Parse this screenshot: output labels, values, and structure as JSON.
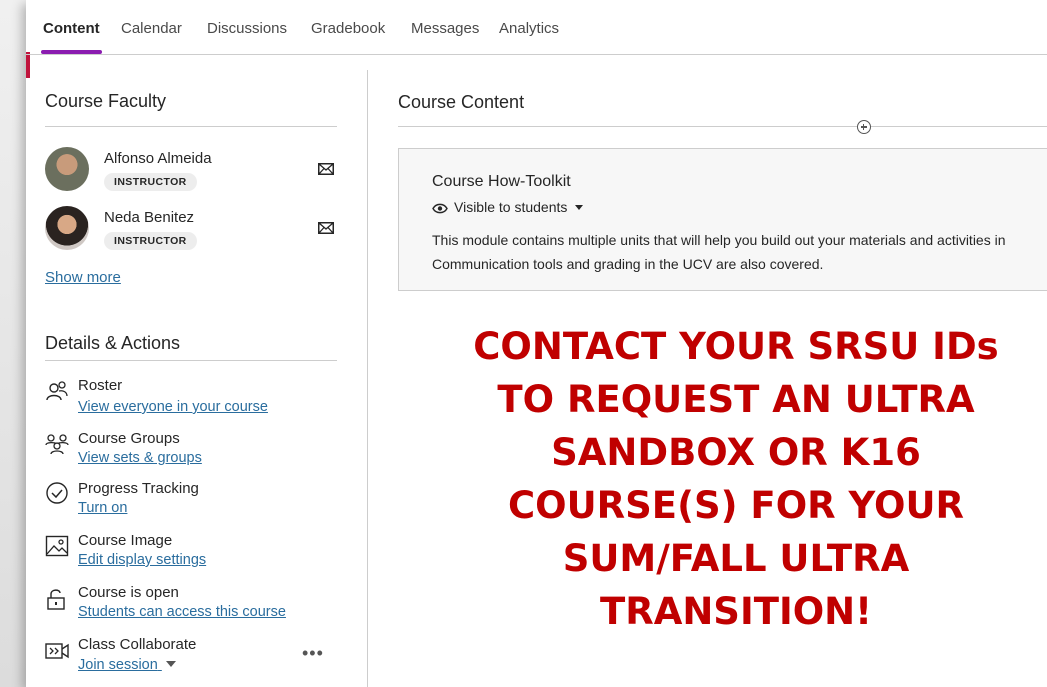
{
  "tabs": [
    {
      "label": "Content",
      "active": true
    },
    {
      "label": "Calendar",
      "active": false
    },
    {
      "label": "Discussions",
      "active": false
    },
    {
      "label": "Gradebook",
      "active": false
    },
    {
      "label": "Messages",
      "active": false
    },
    {
      "label": "Analytics",
      "active": false
    }
  ],
  "faculty": {
    "title": "Course Faculty",
    "members": [
      {
        "name": "Alfonso Almeida",
        "role": "INSTRUCTOR"
      },
      {
        "name": "Neda Benitez",
        "role": "INSTRUCTOR"
      }
    ],
    "show_more": "Show more"
  },
  "details": {
    "title": "Details & Actions",
    "items": [
      {
        "title": "Roster",
        "link": "View everyone in your course",
        "icon": "roster-icon"
      },
      {
        "title": "Course Groups",
        "link": "View sets & groups",
        "icon": "groups-icon"
      },
      {
        "title": "Progress Tracking",
        "link": "Turn on",
        "icon": "progress-check-icon"
      },
      {
        "title": "Course Image",
        "link": "Edit display settings",
        "icon": "image-icon"
      },
      {
        "title": "Course is open",
        "link": "Students can access this course",
        "icon": "unlock-icon"
      },
      {
        "title": "Class Collaborate",
        "link": "Join session",
        "icon": "collaborate-icon"
      }
    ]
  },
  "content": {
    "title": "Course Content",
    "module": {
      "title": "Course How-Toolkit",
      "visibility": "Visible to students",
      "description_line1": "This module contains multiple units that will help you build out your materials and activities in",
      "description_line2": "Communication tools and grading in the UCV are also covered."
    }
  },
  "callout": {
    "lines": [
      "CONTACT YOUR SRSU IDs",
      "TO REQUEST AN ULTRA",
      "SANDBOX OR K16",
      "COURSE(S) FOR YOUR",
      "SUM/FALL ULTRA",
      "TRANSITION!"
    ]
  },
  "colors": {
    "accent_purple": "#8b1cb0",
    "accent_red_bar": "#c0143c",
    "link_blue": "#2a6d9e",
    "callout_red": "#c00000"
  }
}
